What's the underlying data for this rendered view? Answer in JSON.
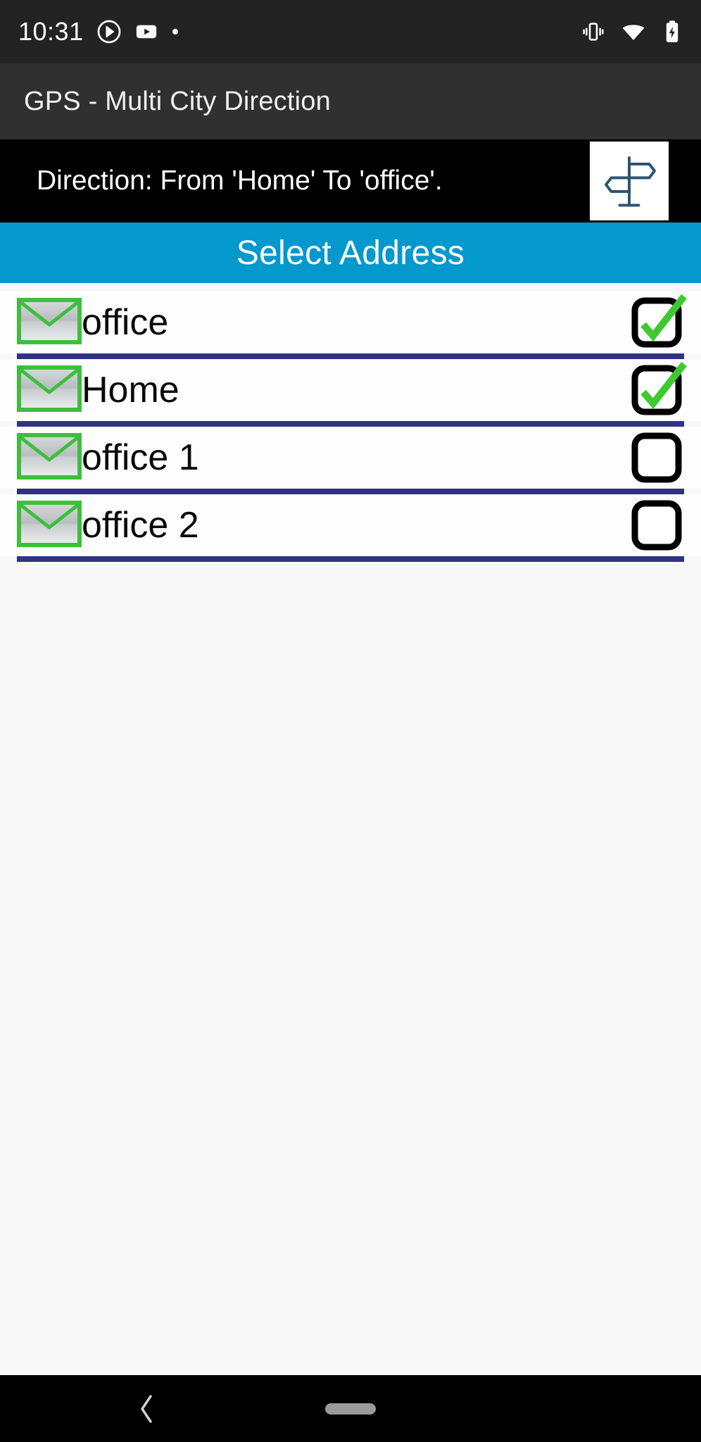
{
  "status_bar": {
    "time": "10:31",
    "left_icons": [
      "cast-circle-icon",
      "youtube-icon",
      "dot-icon"
    ],
    "right_icons": [
      "vibrate-icon",
      "wifi-icon",
      "battery-charging-icon"
    ],
    "background_color": "#232323"
  },
  "app_bar": {
    "title": "GPS - Multi City Direction",
    "background_color": "#303030",
    "text_color": "#f0f0f0"
  },
  "direction_banner": {
    "text": "Direction: From 'Home' To 'office'.",
    "icon": "signpost-icon",
    "background_color": "#000000",
    "icon_color": "#2a5574"
  },
  "select_header": {
    "label": "Select Address",
    "background_color": "#0498cd",
    "text_color": "#ffffff"
  },
  "address_list": {
    "divider_color": "#2f3189",
    "checkbox_border_color": "#000000",
    "check_color": "#3ec92f",
    "envelope_border_color": "#3ebe3e",
    "items": [
      {
        "label": "office",
        "checked": true,
        "icon": "envelope-icon"
      },
      {
        "label": "Home",
        "checked": true,
        "icon": "envelope-icon"
      },
      {
        "label": "office 1",
        "checked": false,
        "icon": "envelope-icon"
      },
      {
        "label": "office 2",
        "checked": false,
        "icon": "envelope-icon"
      }
    ]
  },
  "nav_bar": {
    "background_color": "#000000",
    "back_icon": "chevron-left-icon",
    "home_icon": "home-pill-handle"
  }
}
